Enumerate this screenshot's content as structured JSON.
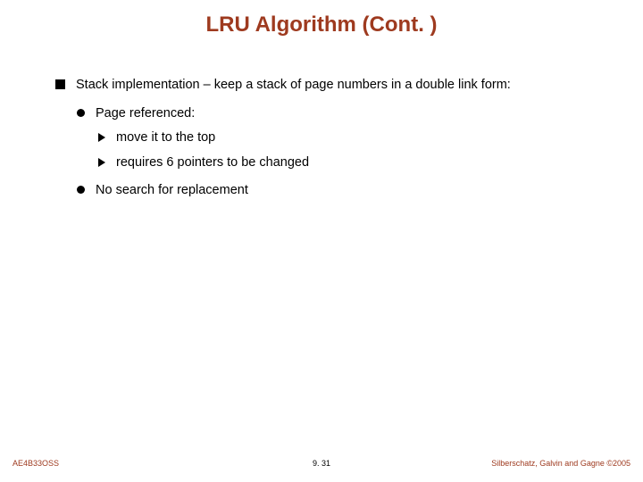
{
  "title": "LRU Algorithm (Cont. )",
  "bullets": {
    "l1": "Stack implementation – keep a stack of page numbers in a double link form:",
    "l2a": "Page referenced:",
    "l3a": "move it to the top",
    "l3b": "requires 6 pointers to be changed",
    "l2b": "No search for replacement"
  },
  "footer": {
    "left": "AE4B33OSS",
    "center": "9. 31",
    "right": "Silberschatz, Galvin and Gagne ©2005"
  }
}
